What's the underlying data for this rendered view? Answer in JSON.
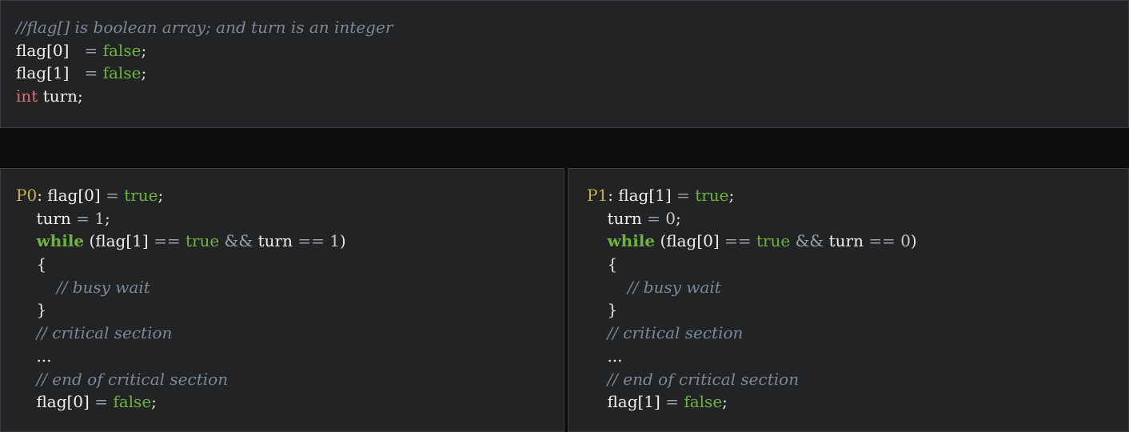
{
  "top": {
    "comment": "//flag[] is boolean array; and turn is an integer",
    "decl": [
      {
        "name": "flag[0]",
        "op": "=",
        "value": "false",
        "end": ";"
      },
      {
        "name": "flag[1]",
        "op": "=",
        "value": "false",
        "end": ";"
      }
    ],
    "int_decl": {
      "type": "int",
      "name": "turn",
      "end": ";"
    }
  },
  "p0": {
    "label": "P0",
    "colon": ":",
    "set_flag": {
      "name": "flag[0]",
      "op": "=",
      "value": "true",
      "end": ";"
    },
    "set_turn": {
      "name": "turn",
      "op": "=",
      "value": "1",
      "end": ";"
    },
    "while": {
      "kw": "while",
      "open": "(",
      "lhs": "flag[1]",
      "eq1": "==",
      "rhs1": "true",
      "and": "&&",
      "turn": "turn",
      "eq2": "==",
      "rhs2": "1",
      "close": ")"
    },
    "brace_open": "{",
    "busy_wait": "// busy wait",
    "brace_close": "}",
    "crit_comment": "// critical section",
    "ellipsis": "...",
    "end_comment": "// end of critical section",
    "reset_flag": {
      "name": "flag[0]",
      "op": "=",
      "value": "false",
      "end": ";"
    }
  },
  "p1": {
    "label": "P1",
    "colon": ":",
    "set_flag": {
      "name": "flag[1]",
      "op": "=",
      "value": "true",
      "end": ";"
    },
    "set_turn": {
      "name": "turn",
      "op": "=",
      "value": "0",
      "end": ";"
    },
    "while": {
      "kw": "while",
      "open": "(",
      "lhs": "flag[0]",
      "eq1": "==",
      "rhs1": "true",
      "and": "&&",
      "turn": "turn",
      "eq2": "==",
      "rhs2": "0",
      "close": ")"
    },
    "brace_open": "{",
    "busy_wait": "// busy wait",
    "brace_close": "}",
    "crit_comment": "// critical section",
    "ellipsis": "...",
    "end_comment": "// end of critical section",
    "reset_flag": {
      "name": "flag[1]",
      "op": "=",
      "value": "false",
      "end": ";"
    }
  }
}
